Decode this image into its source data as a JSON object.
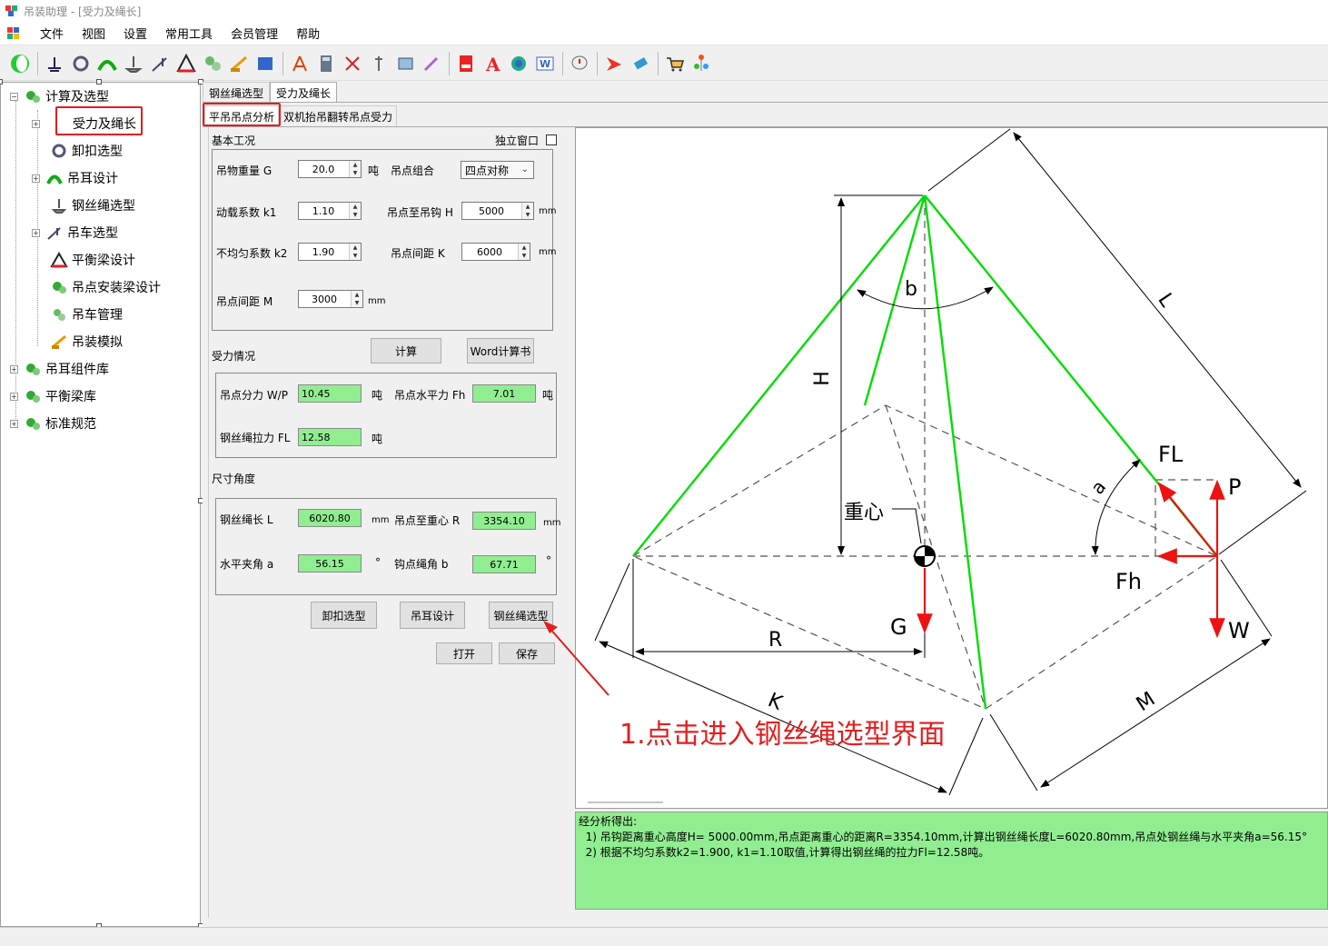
{
  "window": {
    "title": "吊装助理 - [受力及绳长]"
  },
  "menu": [
    "文件",
    "视图",
    "设置",
    "常用工具",
    "会员管理",
    "帮助"
  ],
  "toolbar_icons": [
    "ring-icon",
    "level-icon",
    "shackle-icon",
    "lug-icon",
    "anchor-icon",
    "crane-icon",
    "frame-icon",
    "gear-cluster-icon",
    "crane2-icon",
    "image-icon",
    "compass-icon",
    "calculator-icon",
    "scissors-icon",
    "tool-icon",
    "doc-icon",
    "pen-icon",
    "pdf-icon",
    "text-a-icon",
    "refresh-icon",
    "word-icon",
    "comment-icon",
    "arrow-icon",
    "eraser-icon",
    "cart-icon",
    "tree-icon"
  ],
  "tree": {
    "root": "计算及选型",
    "items": [
      "受力及绳长",
      "卸扣选型",
      "吊耳设计",
      "钢丝绳选型",
      "吊车选型",
      "平衡梁设计",
      "吊点安装梁设计",
      "吊车管理",
      "吊装模拟"
    ],
    "libs": [
      "吊耳组件库",
      "平衡梁库",
      "标准规范"
    ]
  },
  "tabs": {
    "outer": [
      "钢丝绳选型",
      "受力及绳长"
    ],
    "inner": [
      "平吊吊点分析",
      "双机抬吊翻转吊点受力"
    ]
  },
  "basic": {
    "group_title": "基本工况",
    "standalone_label": "独立窗口",
    "weight_label": "吊物重量 G",
    "weight_value": "20.0",
    "weight_unit": "吨",
    "combo_label": "吊点组合",
    "combo_value": "四点对称",
    "k1_label": "动载系数 k1",
    "k1_value": "1.10",
    "h_label": "吊点至吊钩 H",
    "h_value": "5000",
    "h_unit": "mm",
    "k2_label": "不均匀系数 k2",
    "k2_value": "1.90",
    "kdist_label": "吊点间距 K",
    "kdist_value": "6000",
    "kdist_unit": "mm",
    "m_label": "吊点间距 M",
    "m_value": "3000",
    "m_unit": "mm"
  },
  "buttons": {
    "calc": "计算",
    "word": "Word计算书",
    "shackle": "卸扣选型",
    "lug": "吊耳设计",
    "rope": "钢丝绳选型",
    "open": "打开",
    "save": "保存"
  },
  "force": {
    "group_title": "受力情况",
    "wp_label": "吊点分力 W/P",
    "wp_value": "10.45",
    "wp_unit": "吨",
    "fh_label": "吊点水平力 Fh",
    "fh_value": "7.01",
    "fh_unit": "吨",
    "fl_label": "钢丝绳拉力 FL",
    "fl_value": "12.58",
    "fl_unit": "吨"
  },
  "dims": {
    "group_title": "尺寸角度",
    "l_label": "钢丝绳长 L",
    "l_value": "6020.80",
    "l_unit": "mm",
    "r_label": "吊点至重心 R",
    "r_value": "3354.10",
    "r_unit": "mm",
    "a_label": "水平夹角 a",
    "a_value": "56.15",
    "a_unit": "°",
    "b_label": "钩点绳角 b",
    "b_value": "67.71",
    "b_unit": "°"
  },
  "diagram": {
    "labels": {
      "L": "L",
      "H": "H",
      "b": "b",
      "a": "a",
      "FL": "FL",
      "P": "P",
      "Fh": "Fh",
      "W": "W",
      "G": "G",
      "R": "R",
      "K": "K",
      "M": "M",
      "cog": "重心"
    },
    "annotation": "1.点击进入钢丝绳选型界面"
  },
  "result": {
    "heading": "经分析得出:",
    "line1": "  1) 吊钩距离重心高度H= 5000.00mm,吊点距离重心的距离R=3354.10mm,计算出钢丝绳长度L=6020.80mm,吊点处钢丝绳与水平夹角a=56.15°",
    "line2": "  2) 根据不均匀系数k2=1.900, k1=1.10取值,计算得出钢丝绳的拉力Fl=12.58吨。"
  },
  "colors": {
    "rope": "#00dd00",
    "force": "#ee1111",
    "result_bg": "#90ee90",
    "highlight": "#e21e1e"
  }
}
